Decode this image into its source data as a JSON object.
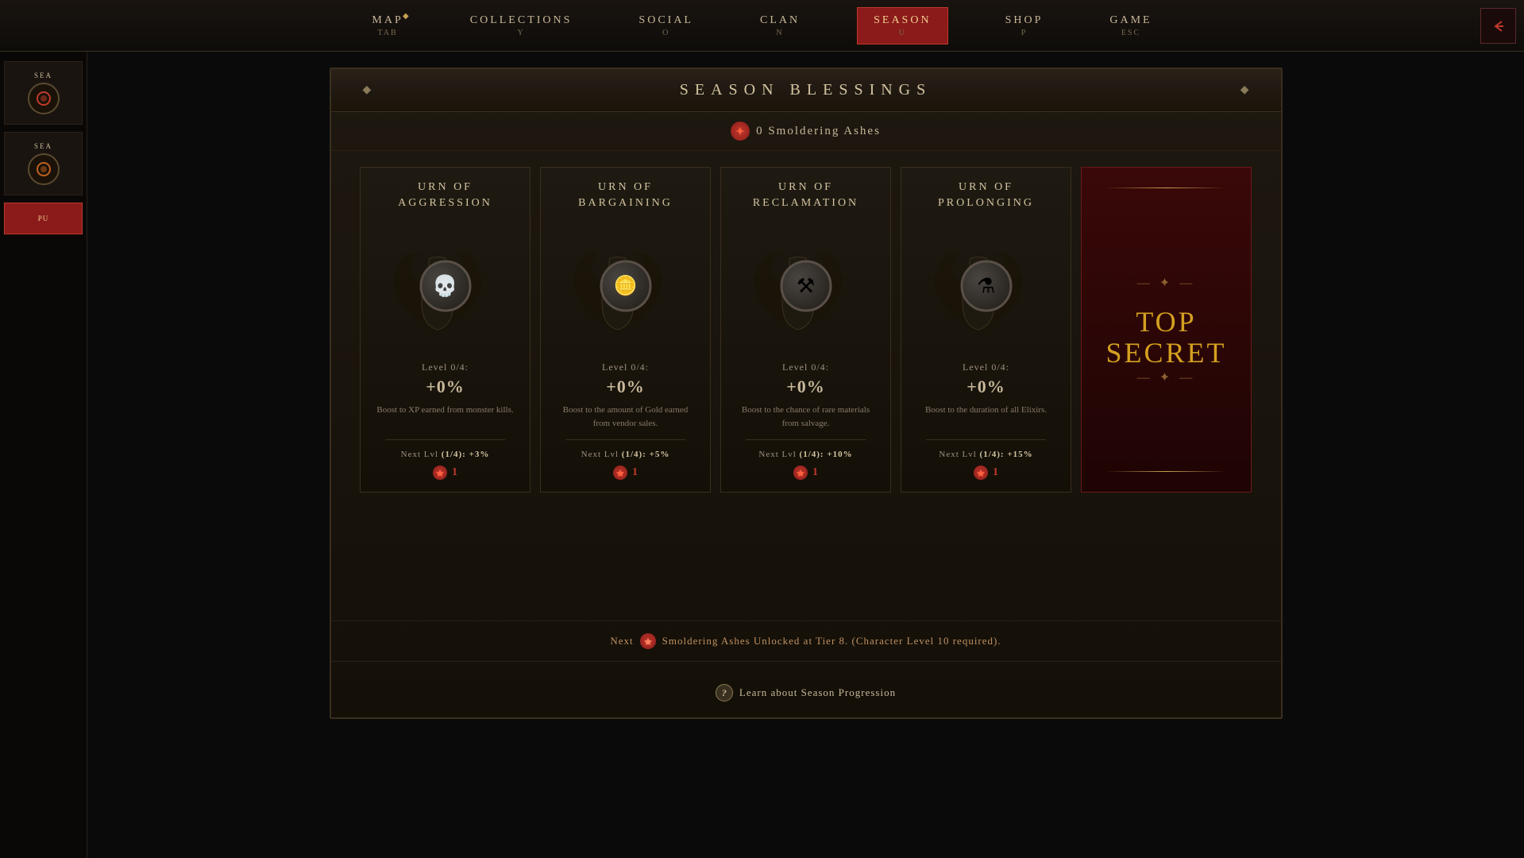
{
  "nav": {
    "items": [
      {
        "label": "MAP",
        "key": "TAB",
        "active": false,
        "has_diamond": true
      },
      {
        "label": "COLLECTIONS",
        "key": "Y",
        "active": false,
        "has_diamond": false
      },
      {
        "label": "SOCIAL",
        "key": "O",
        "active": false,
        "has_diamond": false
      },
      {
        "label": "CLAN",
        "key": "N",
        "active": false,
        "has_diamond": false
      },
      {
        "label": "SEASON",
        "key": "U",
        "active": true,
        "has_diamond": false
      },
      {
        "label": "SHOP",
        "key": "P",
        "active": false,
        "has_diamond": false
      },
      {
        "label": "GAME",
        "key": "ESC",
        "active": false,
        "has_diamond": false
      }
    ]
  },
  "panel": {
    "title": "SEASON BLESSINGS",
    "ashes_count": "0",
    "ashes_label": "Smoldering Ashes"
  },
  "blessings": [
    {
      "id": "aggression",
      "title": "URN OF\nAGGRESSION",
      "icon": "💀",
      "level": "Level 0/4:",
      "bonus": "+0%",
      "description": "Boost to XP earned from monster kills.",
      "next_level": "Next Lvl (1/4): +3%",
      "cost": "1"
    },
    {
      "id": "bargaining",
      "title": "URN OF\nBARGAINING",
      "icon": "🪙",
      "level": "Level 0/4:",
      "bonus": "+0%",
      "description": "Boost to the amount of Gold earned from vendor sales.",
      "next_level": "Next Lvl (1/4): +5%",
      "cost": "1"
    },
    {
      "id": "reclamation",
      "title": "URN OF\nRECLAMATION",
      "icon": "⚒",
      "level": "Level 0/4:",
      "bonus": "+0%",
      "description": "Boost to the chance of rare materials from salvage.",
      "next_level": "Next Lvl (1/4): +10%",
      "cost": "1"
    },
    {
      "id": "prolonging",
      "title": "URN OF\nPROLONGING",
      "icon": "⚗",
      "level": "Level 0/4:",
      "bonus": "+0%",
      "description": "Boost to the duration of all Elixirs.",
      "next_level": "Next Lvl (1/4): +15%",
      "cost": "1"
    }
  ],
  "sidebar": {
    "items": [
      {
        "label": "SEA",
        "has_icon": true
      },
      {
        "label": "SEA",
        "has_icon": true
      }
    ],
    "button_label": "PU"
  },
  "bottom_info": {
    "prefix": "Next",
    "main_text": "Smoldering Ashes Unlocked at Tier 8.  (Character Level 10 required)."
  },
  "learn_link": {
    "text": "Learn about Season Progression"
  }
}
